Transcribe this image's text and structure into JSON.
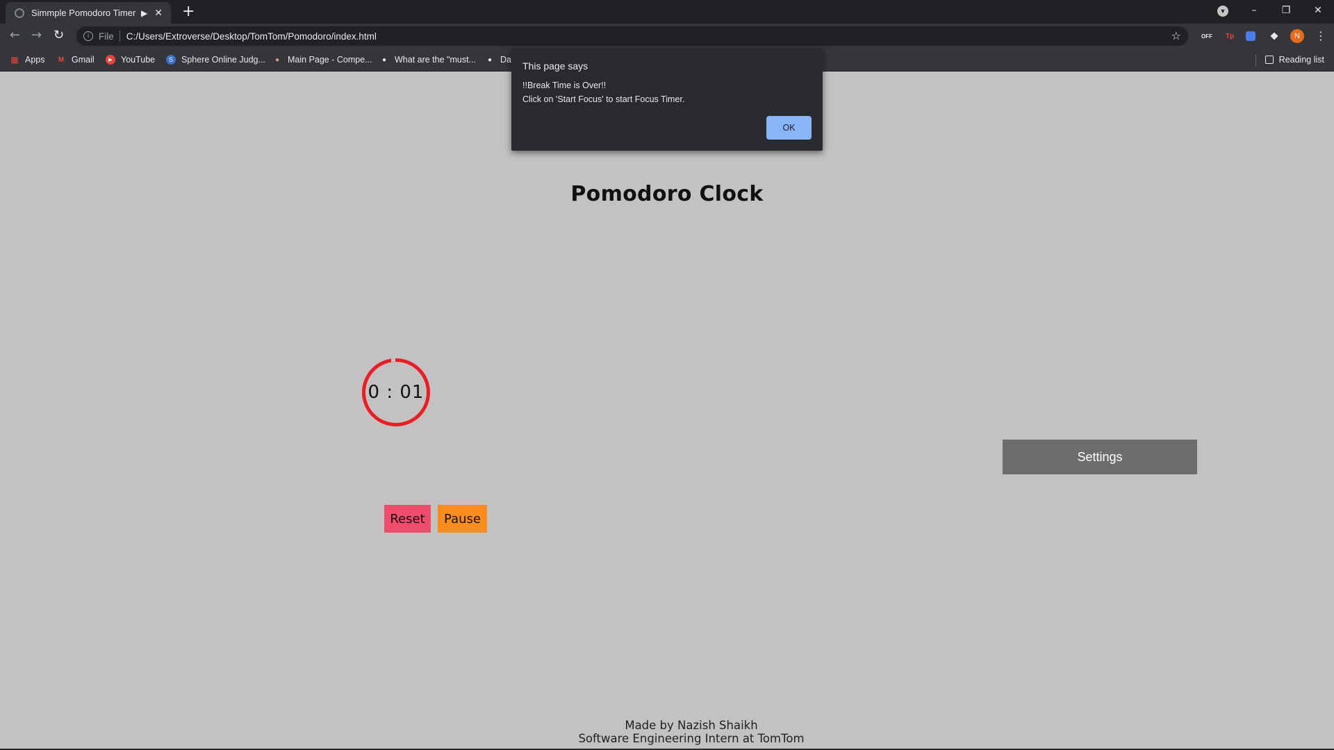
{
  "browser": {
    "tab_title": "Simmple Pomodoro Timer",
    "url_scheme": "File",
    "url": "C:/Users/Extroverse/Desktop/TomTom/Pomodoro/index.html",
    "ext_off_label": "OFF",
    "ext_tp_label": "Tp",
    "profile_initial": "N",
    "bookmarks": [
      "Apps",
      "Gmail",
      "YouTube",
      "Sphere Online Judg...",
      "Main Page - Compe...",
      "What are the \"must...",
      "Da"
    ],
    "reading_list": "Reading list"
  },
  "dialog": {
    "title": "This page says",
    "line1": "!!Break Time is Over!!",
    "line2": "Click on 'Start Focus' to start Focus Timer.",
    "ok_label": "OK"
  },
  "page": {
    "title": "Pomodoro Clock",
    "timer": "0 : 01",
    "reset_label": "Reset",
    "pause_label": "Pause",
    "settings_label": "Settings",
    "footer_line1": "Made by Nazish Shaikh",
    "footer_line2": "Software Engineering Intern at TomTom"
  },
  "colors": {
    "page_bg": "#c3c1c2",
    "ring": "#ea1c24",
    "reset_bg": "#f24c6c",
    "pause_bg": "#fb8c1e",
    "settings_bg": "#6c6c6c",
    "ok_bg": "#8ab4f8"
  }
}
